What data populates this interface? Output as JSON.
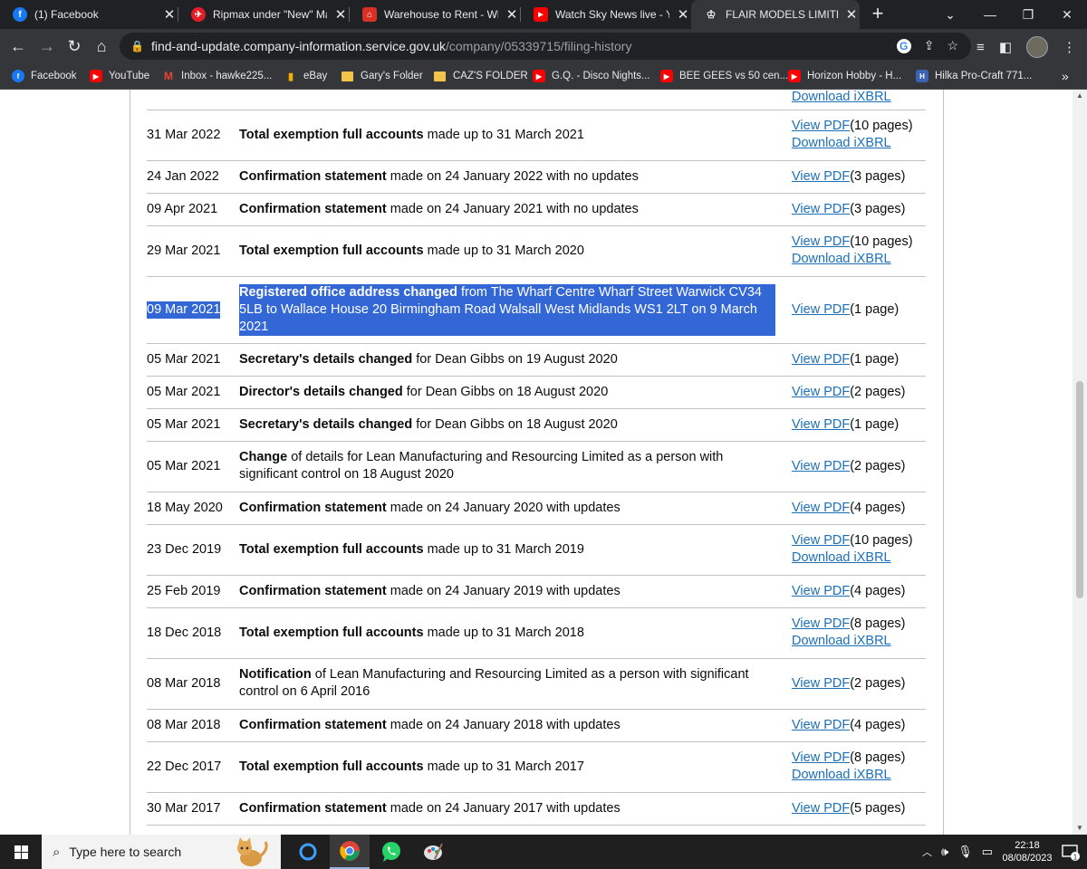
{
  "browser": {
    "tabs": [
      {
        "title": "(1) Facebook",
        "icon": "facebook-icon"
      },
      {
        "title": "Ripmax under \"New\" Mar",
        "icon": "ripmax-icon"
      },
      {
        "title": "Warehouse to Rent - Wha",
        "icon": "rent-icon"
      },
      {
        "title": "Watch Sky News live - You",
        "icon": "youtube-icon"
      },
      {
        "title": "FLAIR MODELS LIMITED fi",
        "icon": "crown-icon"
      }
    ],
    "url_host": "find-and-update.company-information.service.gov.uk",
    "url_path": "/company/05339715/filing-history",
    "bookmarks": [
      {
        "label": "Facebook",
        "icon": "facebook-icon"
      },
      {
        "label": "YouTube",
        "icon": "youtube-icon"
      },
      {
        "label": "Inbox - hawke225...",
        "icon": "gmail-icon"
      },
      {
        "label": "eBay",
        "icon": "ebay-icon"
      },
      {
        "label": "Gary's Folder",
        "icon": "folder-icon"
      },
      {
        "label": "CAZ'S FOLDER",
        "icon": "folder-icon"
      },
      {
        "label": "G.Q. - Disco Nights...",
        "icon": "youtube-icon"
      },
      {
        "label": "BEE GEES vs 50 cen...",
        "icon": "youtube-icon"
      },
      {
        "label": "Horizon Hobby - H...",
        "icon": "youtube-icon"
      },
      {
        "label": "Hilka Pro-Craft 771...",
        "icon": "hilka-icon"
      }
    ],
    "more_bookmarks": "»"
  },
  "filings": {
    "top_partial_link": "Download iXBRL",
    "rows": [
      {
        "date": "31 Mar 2022",
        "bold": "Total exemption full accounts",
        "rest": " made up to 31 March 2021",
        "pdf": "View PDF",
        "pages": "(10 pages)",
        "xbrl": "Download iXBRL"
      },
      {
        "date": "24 Jan 2022",
        "bold": "Confirmation statement",
        "rest": " made on 24 January 2022 with no updates",
        "pdf": "View PDF",
        "pages": "(3 pages)",
        "xbrl": ""
      },
      {
        "date": "09 Apr 2021",
        "bold": "Confirmation statement",
        "rest": " made on 24 January 2021 with no updates",
        "pdf": "View PDF",
        "pages": "(3 pages)",
        "xbrl": ""
      },
      {
        "date": "29 Mar 2021",
        "bold": "Total exemption full accounts",
        "rest": " made up to 31 March 2020",
        "pdf": "View PDF",
        "pages": "(10 pages)",
        "xbrl": "Download iXBRL"
      },
      {
        "date": "09 Mar 2021",
        "bold": "Registered office address changed",
        "rest": " from The Wharf Centre Wharf Street Warwick CV34 5LB to Wallace House 20 Birmingham Road Walsall West Midlands WS1 2LT on 9 March 2021",
        "pdf": "View PDF",
        "pages": "(1 page)",
        "xbrl": ""
      },
      {
        "date": "05 Mar 2021",
        "bold": "Secretary's details changed",
        "rest": " for Dean Gibbs on 19 August 2020",
        "pdf": "View PDF",
        "pages": "(1 page)",
        "xbrl": ""
      },
      {
        "date": "05 Mar 2021",
        "bold": "Director's details changed",
        "rest": " for Dean Gibbs on 18 August 2020",
        "pdf": "View PDF",
        "pages": "(2 pages)",
        "xbrl": ""
      },
      {
        "date": "05 Mar 2021",
        "bold": "Secretary's details changed",
        "rest": " for Dean Gibbs on 18 August 2020",
        "pdf": "View PDF",
        "pages": "(1 page)",
        "xbrl": ""
      },
      {
        "date": "05 Mar 2021",
        "bold": "Change",
        "rest": " of details for Lean Manufacturing and Resourcing Limited as a person with significant control on 18 August 2020",
        "pdf": "View PDF",
        "pages": "(2 pages)",
        "xbrl": ""
      },
      {
        "date": "18 May 2020",
        "bold": "Confirmation statement",
        "rest": " made on 24 January 2020 with updates",
        "pdf": "View PDF",
        "pages": "(4 pages)",
        "xbrl": ""
      },
      {
        "date": "23 Dec 2019",
        "bold": "Total exemption full accounts",
        "rest": " made up to 31 March 2019",
        "pdf": "View PDF",
        "pages": "(10 pages)",
        "xbrl": "Download iXBRL"
      },
      {
        "date": "25 Feb 2019",
        "bold": "Confirmation statement",
        "rest": " made on 24 January 2019 with updates",
        "pdf": "View PDF",
        "pages": "(4 pages)",
        "xbrl": ""
      },
      {
        "date": "18 Dec 2018",
        "bold": "Total exemption full accounts",
        "rest": " made up to 31 March 2018",
        "pdf": "View PDF",
        "pages": "(8 pages)",
        "xbrl": "Download iXBRL"
      },
      {
        "date": "08 Mar 2018",
        "bold": "Notification",
        "rest": " of Lean Manufacturing and Resourcing Limited as a person with significant control on 6 April 2016",
        "pdf": "View PDF",
        "pages": "(2 pages)",
        "xbrl": ""
      },
      {
        "date": "08 Mar 2018",
        "bold": "Confirmation statement",
        "rest": " made on 24 January 2018 with updates",
        "pdf": "View PDF",
        "pages": "(4 pages)",
        "xbrl": ""
      },
      {
        "date": "22 Dec 2017",
        "bold": "Total exemption full accounts",
        "rest": " made up to 31 March 2017",
        "pdf": "View PDF",
        "pages": "(8 pages)",
        "xbrl": "Download iXBRL"
      },
      {
        "date": "30 Mar 2017",
        "bold": "Confirmation statement",
        "rest": " made on 24 January 2017 with updates",
        "pdf": "View PDF",
        "pages": "(5 pages)",
        "xbrl": ""
      }
    ],
    "selected_row": 4
  },
  "taskbar": {
    "search_placeholder": "Type here to search",
    "time": "22:18",
    "date": "08/08/2023",
    "notification_count": "1"
  },
  "colors": {
    "link": "#1d70b8",
    "selection": "#3367d6",
    "chrome_dark": "#202124",
    "chrome_bar": "#35363a"
  }
}
